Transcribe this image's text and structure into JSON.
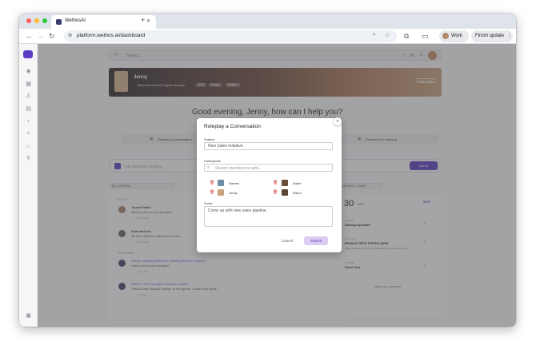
{
  "browser": {
    "tab_title": "WethosAI",
    "tab_close": "✕",
    "new_tab": "+",
    "url": "platform.wethos.ai/dashboard",
    "profile_label": "Work",
    "finish_update_label": "Finish update",
    "colors": {
      "close": "#ff5f57",
      "minimize": "#febc2e",
      "maximize": "#28c840"
    }
  },
  "app": {
    "brand_color": "#5b3cc4",
    "search_placeholder": "Search",
    "profile": {
      "name": "Jenny",
      "subtitle": "Behavioral Science Program Manager",
      "tags": [
        "INTJ",
        "Yearly",
        "Badges"
      ],
      "edit_label": "Edit Profile"
    },
    "greeting": "Good evening, Jenny, how can I help you?",
    "actions": [
      {
        "label": "Roleplay a conversation"
      },
      {
        "label": "Prepare for a meeting"
      }
    ],
    "ask_placeholder": "Ask WethosAI anything...",
    "ask_button": "Ask AI",
    "feed": {
      "filter_label": "ALL UPDATES",
      "sections": [
        {
          "header": "TODAY",
          "items": [
            {
              "author": "Jessica Fradet",
              "text": "@Jenny what are your thoughts?",
              "meta": "2 hours ago"
            },
            {
              "author": "Stuart McClure",
              "text": "We have decided to implement the new...",
              "meta": "4 hours ago"
            }
          ]
        },
        {
          "header": "YESTERDAY",
          "items": [
            {
              "text": "Jenny what are your thoughts?",
              "link": "Wethos - Bridging Differences: Working Effectively Together",
              "meta": "1 day ago"
            },
            {
              "text": "\"Wethos Daily Standup Training\" on the agenda. I couldn't find specs...",
              "link": "Wethos - Team Strengths & Behavior Analysis",
              "meta": "1 day ago"
            }
          ]
        }
      ]
    },
    "calendar": {
      "filter_label": "SCHEDULE, TODAY",
      "day_number": "30",
      "day_suffix": "MAR",
      "status": "BUSY",
      "events": [
        {
          "time": "9:30 AM",
          "title": "Standup Sync/Web",
          "meta": "+4"
        },
        {
          "time": "11:00 AM",
          "title": "PRODUCT BETA TESTING (MVP)",
          "desc": "Sales collateral spec can be included in discussion as well",
          "meta": "+2"
        },
        {
          "time": "2:00 PM",
          "title": "Focus Time",
          "meta": "+1"
        }
      ],
      "view_calendar": "VIEW FULL CALENDAR"
    }
  },
  "modal": {
    "title": "Roleplay a Conversation",
    "subject_label": "Subject",
    "subject_value": "New Sales Initiative",
    "participants_label": "Participants",
    "participants_placeholder": "Search members to add...",
    "participants": [
      {
        "name": "Darnes"
      },
      {
        "name": "Adam"
      },
      {
        "name": "Jenny"
      },
      {
        "name": "Rahul"
      }
    ],
    "goals_label": "Goals",
    "goals_value": "Come up with new sales pipeline",
    "cancel_label": "Cancel",
    "submit_label": "Submit",
    "close_symbol": "✕"
  }
}
